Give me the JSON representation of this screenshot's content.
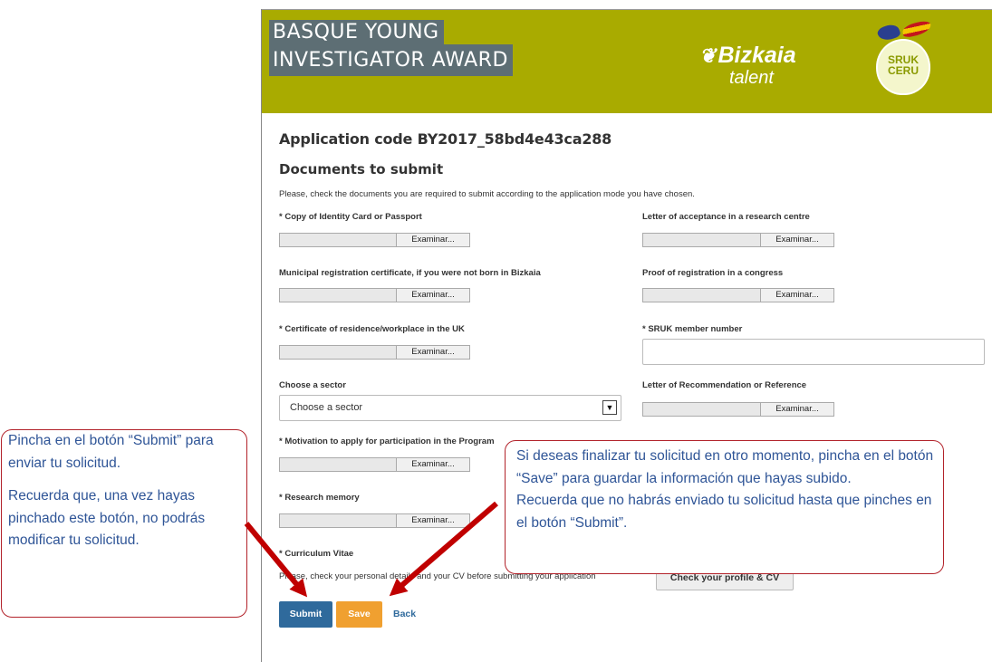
{
  "header": {
    "title_line1": "BASQUE YOUNG",
    "title_line2": "INVESTIGATOR AWARD",
    "logo_bizkaia": "Bizkaia",
    "logo_talent": "talent",
    "logo_sruk": "SRUK",
    "logo_ceru": "CERU"
  },
  "page": {
    "application_code": "Application code BY2017_58bd4e43ca288",
    "documents_title": "Documents to submit",
    "intro": "Please, check the documents you are required to submit according to the application mode you have chosen."
  },
  "fields": {
    "identity": "* Copy of Identity Card or Passport",
    "acceptance": "Letter of acceptance in a research centre",
    "municipal": "Municipal registration certificate, if you were not born in Bizkaia",
    "congress": "Proof of registration in a congress",
    "residence": "* Certificate of residence/workplace in the UK",
    "sruk_member": "* SRUK member number",
    "sector_label": "Choose a sector",
    "sector_selected": "Choose a sector",
    "recommendation": "Letter of Recommendation or Reference",
    "motivation": "* Motivation to apply for participation in the Program",
    "research_memory": "* Research memory",
    "cv": "* Curriculum Vitae",
    "cv_note": "Please, check your personal details and your CV before submitting your application",
    "browse": "Examinar..."
  },
  "actions": {
    "check_profile": "Check your profile & CV",
    "submit": "Submit",
    "save": "Save",
    "back": "Back"
  },
  "callouts": {
    "left_p1": "Pincha en el botón “Submit” para enviar tu solicitud.",
    "left_p2": "Recuerda que, una vez hayas pinchado este botón, no podrás modificar tu solicitud.",
    "right_p1": "Si deseas finalizar tu solicitud en otro momento, pincha en el botón “Save” para guardar la información que hayas subido.",
    "right_p2": "Recuerda que no habrás enviado tu solicitud hasta que pinches en el botón “Submit”."
  },
  "colors": {
    "banner": "#a9ab00",
    "title_bg": "#5d6e74",
    "submit": "#2f6a9c",
    "save": "#f0a030",
    "callout_border": "#b2222a",
    "callout_text": "#2f5597",
    "arrow": "#c00000"
  }
}
